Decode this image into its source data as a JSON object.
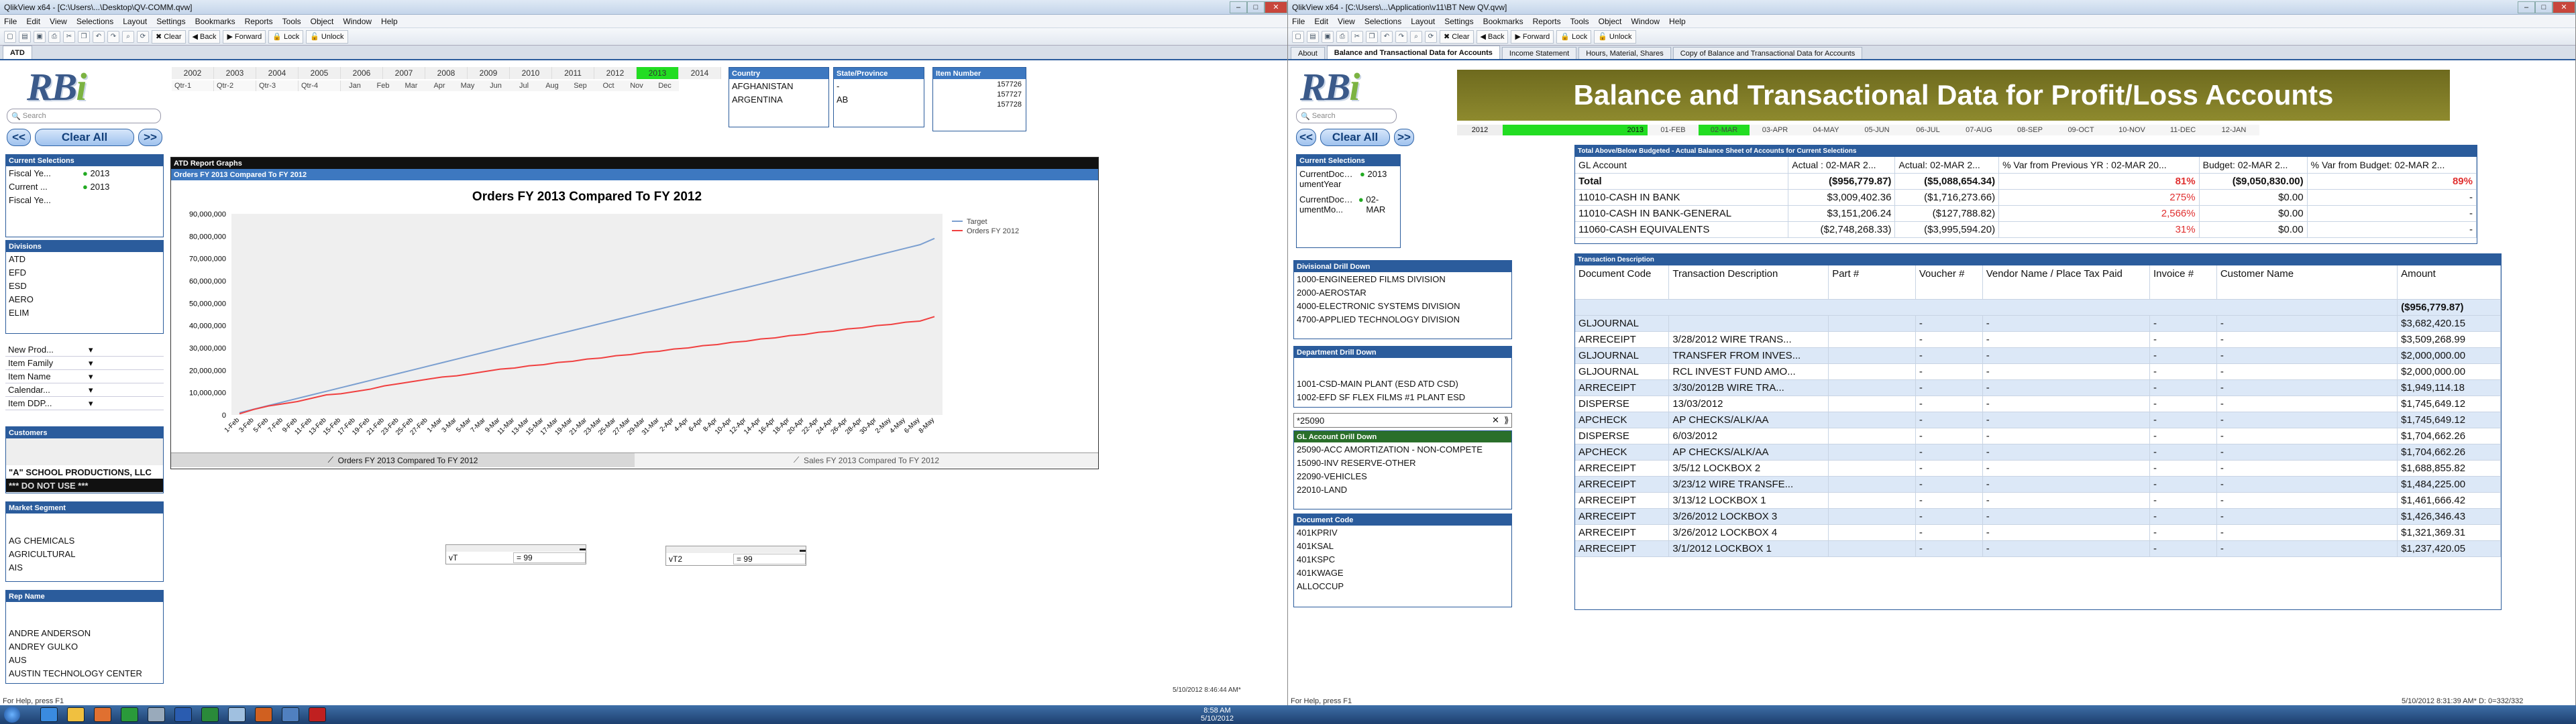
{
  "left": {
    "title": "QlikView x64 - [C:\\Users\\...\\Desktop\\QV-COMM.qvw]",
    "menu": [
      "File",
      "Edit",
      "View",
      "Selections",
      "Layout",
      "Settings",
      "Bookmarks",
      "Reports",
      "Tools",
      "Object",
      "Window",
      "Help"
    ],
    "toolbar": {
      "clear": "Clear",
      "back": "Back",
      "forward": "Forward",
      "lock": "Lock",
      "unlock": "Unlock"
    },
    "tab": "ATD",
    "search_placeholder": "Search",
    "clear_all": "Clear All",
    "years": [
      "2002",
      "2003",
      "2004",
      "2005",
      "2006",
      "2007",
      "2008",
      "2009",
      "2010",
      "2011",
      "2012",
      "2013",
      "2014"
    ],
    "quarters": [
      "Qtr-1",
      "Qtr-2",
      "Qtr-3",
      "Qtr-4"
    ],
    "months": [
      "Jan",
      "Feb",
      "Mar",
      "Apr",
      "May",
      "Jun",
      "Jul",
      "Aug",
      "Sep",
      "Oct",
      "Nov",
      "Dec"
    ],
    "country": {
      "title": "Country",
      "items": [
        "AFGHANISTAN",
        "ARGENTINA"
      ]
    },
    "state": {
      "title": "State/Province",
      "items": [
        "-",
        "AB"
      ]
    },
    "item": {
      "title": "Item Number",
      "items": [
        "157726",
        "157727",
        "157728"
      ]
    },
    "current": {
      "title": "Current Selections",
      "rows": [
        {
          "k": "Fiscal Ye...",
          "v": "2013"
        },
        {
          "k": "Current ...",
          "v": "2013"
        },
        {
          "k": "Fiscal Ye...",
          "v": ""
        }
      ]
    },
    "divisions": {
      "title": "Divisions",
      "items": [
        "ATD",
        "EFD",
        "ESD",
        "AERO",
        "ELIM"
      ]
    },
    "filters": [
      "New Prod...",
      "Item Family",
      "Item Name",
      "Calendar...",
      "Item DDP..."
    ],
    "customers": {
      "title": "Customers",
      "items": [
        "\"A\" SCHOOL PRODUCTIONS, LLC",
        "*** DO NOT USE ***"
      ]
    },
    "market": {
      "title": "Market Segment",
      "items": [
        "AG CHEMICALS",
        "AGRICULTURAL",
        "AIS"
      ]
    },
    "rep": {
      "title": "Rep Name",
      "items": [
        "ANDRE ANDERSON",
        "ANDREY GULKO",
        "AUS",
        "AUSTIN TECHNOLOGY CENTER"
      ]
    },
    "graphs_title": "ATD Report Graphs",
    "graph_caption": "Orders FY 2013 Compared To FY 2012",
    "bottom_tabs": [
      "Orders FY 2013 Compared To FY 2012",
      "Sales FY 2013 Compared To FY 2012"
    ],
    "vt1": {
      "label": "vT",
      "value": "= 99"
    },
    "vt2": {
      "label": "vT2",
      "value": "= 99"
    },
    "status_left": "For Help, press F1",
    "status_right": "5/10/2012 8:46:44 AM*"
  },
  "chart_data": {
    "type": "line",
    "title": "Orders FY 2013 Compared To FY 2012",
    "ylim": [
      0,
      90000000
    ],
    "yticks": [
      0,
      10000000,
      20000000,
      30000000,
      40000000,
      50000000,
      60000000,
      70000000,
      80000000,
      90000000
    ],
    "x": [
      "1-Feb",
      "3-Feb",
      "5-Feb",
      "7-Feb",
      "9-Feb",
      "11-Feb",
      "13-Feb",
      "15-Feb",
      "17-Feb",
      "19-Feb",
      "21-Feb",
      "23-Feb",
      "25-Feb",
      "27-Feb",
      "1-Mar",
      "3-Mar",
      "5-Mar",
      "7-Mar",
      "9-Mar",
      "11-Mar",
      "13-Mar",
      "15-Mar",
      "17-Mar",
      "19-Mar",
      "21-Mar",
      "23-Mar",
      "25-Mar",
      "27-Mar",
      "29-Mar",
      "31-Mar",
      "2-Apr",
      "4-Apr",
      "6-Apr",
      "8-Apr",
      "10-Apr",
      "12-Apr",
      "14-Apr",
      "16-Apr",
      "18-Apr",
      "20-Apr",
      "22-Apr",
      "24-Apr",
      "26-Apr",
      "28-Apr",
      "30-Apr",
      "2-May",
      "4-May",
      "6-May",
      "8-May"
    ],
    "series": [
      {
        "name": "Target",
        "color": "#7b9fd0",
        "values": [
          1000000,
          2600000,
          4200000,
          5800000,
          7400000,
          9000000,
          10600000,
          12200000,
          13800000,
          15400000,
          17000000,
          18600000,
          20200000,
          21800000,
          23400000,
          25000000,
          26600000,
          28200000,
          29800000,
          31400000,
          33000000,
          34600000,
          36200000,
          37800000,
          39400000,
          41000000,
          42600000,
          44200000,
          45800000,
          47400000,
          49000000,
          50600000,
          52200000,
          53800000,
          55400000,
          57000000,
          58600000,
          60200000,
          61800000,
          63400000,
          65000000,
          66600000,
          68200000,
          69800000,
          71400000,
          73000000,
          74600000,
          76200000,
          79000000
        ]
      },
      {
        "name": "Orders FY 2012",
        "color": "#f04040",
        "values": [
          500000,
          2500000,
          4000000,
          5000000,
          6000000,
          7500000,
          9000000,
          9500000,
          10500000,
          11500000,
          13000000,
          14000000,
          15000000,
          16000000,
          17000000,
          17500000,
          18500000,
          19500000,
          20500000,
          21000000,
          22000000,
          22500000,
          23500000,
          24000000,
          25000000,
          25500000,
          26500000,
          27000000,
          28000000,
          28500000,
          29500000,
          30000000,
          31000000,
          31500000,
          32500000,
          33000000,
          34000000,
          34500000,
          35500000,
          36000000,
          37000000,
          37500000,
          38500000,
          39000000,
          40000000,
          40500000,
          41500000,
          42000000,
          44000000
        ]
      }
    ]
  },
  "right": {
    "title": "QlikView x64 - [C:\\Users\\...\\Application\\v11\\BT New QV.qvw]",
    "menu": [
      "File",
      "Edit",
      "View",
      "Selections",
      "Layout",
      "Settings",
      "Bookmarks",
      "Reports",
      "Tools",
      "Object",
      "Window",
      "Help"
    ],
    "toolbar": {
      "clear": "Clear",
      "back": "Back",
      "forward": "Forward",
      "lock": "Lock",
      "unlock": "Unlock"
    },
    "tabs": [
      "About",
      "Balance and Transactional Data for Accounts",
      "Income Statement",
      "Hours, Material, Shares",
      "Copy of Balance and Transactional Data for Accounts"
    ],
    "search_placeholder": "Search",
    "clear_all": "Clear All",
    "banner": "Balance and Transactional Data for Profit/Loss Accounts",
    "years": [
      "2012",
      "2013"
    ],
    "months": [
      "01-FEB",
      "02-MAR",
      "03-APR",
      "04-MAY",
      "05-JUN",
      "06-JUL",
      "07-AUG",
      "08-SEP",
      "09-OCT",
      "10-NOV",
      "11-DEC",
      "12-JAN"
    ],
    "current": {
      "title": "Current Selections",
      "rows": [
        {
          "k": "CurrentDoc…umentYear",
          "v": "2013"
        },
        {
          "k": "CurrentDoc…umentMo...",
          "v": "02-MAR"
        }
      ]
    },
    "divisional": {
      "title": "Divisional Drill Down",
      "items": [
        "1000-ENGINEERED FILMS DIVISION",
        "2000-AEROSTAR",
        "4000-ELECTRONIC SYSTEMS DIVISION",
        "4700-APPLIED TECHNOLOGY DIVISION"
      ]
    },
    "department": {
      "title": "Department Drill Down",
      "items": [
        "1001-CSD-MAIN PLANT (ESD ATD CSD)",
        "1002-EFD SF FLEX FILMS #1 PLANT ESD"
      ]
    },
    "gl_search": "*25090",
    "gl": {
      "title": "GL Account Drill Down",
      "items": [
        "25090-ACC AMORTIZATION - NON-COMPETE",
        "15090-INV RESERVE-OTHER",
        "22090-VEHICLES",
        "22010-LAND"
      ]
    },
    "doccode": {
      "title": "Document Code",
      "items": [
        "401KPRIV",
        "401KSAL",
        "401KSPC",
        "401KWAGE",
        "ALLOCCUP"
      ]
    },
    "summary": {
      "title": "Total Above/Below Budgeted - Actual Balance Sheet of Accounts for Current Selections",
      "headers": [
        "GL Account",
        "Actual : 02-MAR 2...",
        "Actual: 02-MAR 2...",
        "% Var from Previous YR : 02-MAR 20...",
        "Budget: 02-MAR 2...",
        "% Var from Budget: 02-MAR 2..."
      ],
      "rows": [
        [
          "Total",
          "($956,779.87)",
          "($5,088,654.34)",
          "81%",
          "($9,050,830.00)",
          "89%"
        ],
        [
          "11010-CASH IN BANK",
          "$3,009,402.36",
          "($1,716,273.66)",
          "275%",
          "$0.00",
          "-"
        ],
        [
          "11010-CASH IN BANK-GENERAL",
          "$3,151,206.24",
          "($127,788.82)",
          "2,566%",
          "$0.00",
          "-"
        ],
        [
          "11060-CASH EQUIVALENTS",
          "($2,748,268.33)",
          "($3,995,594.20)",
          "31%",
          "$0.00",
          "-"
        ]
      ]
    },
    "trans": {
      "title": "Transaction Description",
      "headers": [
        "Document Code",
        "Transaction Description",
        "Part #",
        "Voucher #",
        "Vendor Name / Place Tax Paid",
        "Invoice #",
        "Customer Name",
        "Amount"
      ],
      "total": "($956,779.87)",
      "rows": [
        [
          "GLJOURNAL",
          "",
          "",
          "-",
          "-",
          "-",
          "-",
          "$3,682,420.15"
        ],
        [
          "ARRECEIPT",
          "3/28/2012 WIRE TRANS...",
          "",
          "-",
          "-",
          "-",
          "-",
          "$3,509,268.99"
        ],
        [
          "GLJOURNAL",
          "TRANSFER FROM INVES...",
          "",
          "-",
          "-",
          "-",
          "-",
          "$2,000,000.00"
        ],
        [
          "GLJOURNAL",
          "RCL INVEST FUND AMO...",
          "",
          "-",
          "-",
          "-",
          "-",
          "$2,000,000.00"
        ],
        [
          "ARRECEIPT",
          "3/30/2012B WIRE TRA...",
          "",
          "-",
          "-",
          "-",
          "-",
          "$1,949,114.18"
        ],
        [
          "DISPERSE",
          "13/03/2012",
          "",
          "-",
          "-",
          "-",
          "-",
          "$1,745,649.12"
        ],
        [
          "APCHECK",
          "AP CHECKS/ALK/AA",
          "",
          "-",
          "-",
          "-",
          "-",
          "$1,745,649.12"
        ],
        [
          "DISPERSE",
          "6/03/2012",
          "",
          "-",
          "-",
          "-",
          "-",
          "$1,704,662.26"
        ],
        [
          "APCHECK",
          "AP CHECKS/ALK/AA",
          "",
          "-",
          "-",
          "-",
          "-",
          "$1,704,662.26"
        ],
        [
          "ARRECEIPT",
          "3/5/12 LOCKBOX 2",
          "",
          "-",
          "-",
          "-",
          "-",
          "$1,688,855.82"
        ],
        [
          "ARRECEIPT",
          "3/23/12 WIRE TRANSFE...",
          "",
          "-",
          "-",
          "-",
          "-",
          "$1,484,225.00"
        ],
        [
          "ARRECEIPT",
          "3/13/12 LOCKBOX 1",
          "",
          "-",
          "-",
          "-",
          "-",
          "$1,461,666.42"
        ],
        [
          "ARRECEIPT",
          "3/26/2012 LOCKBOX 3",
          "",
          "-",
          "-",
          "-",
          "-",
          "$1,426,346.43"
        ],
        [
          "ARRECEIPT",
          "3/26/2012 LOCKBOX 4",
          "",
          "-",
          "-",
          "-",
          "-",
          "$1,321,369.31"
        ],
        [
          "ARRECEIPT",
          "3/1/2012 LOCKBOX 1",
          "",
          "-",
          "-",
          "-",
          "-",
          "$1,237,420.05"
        ]
      ]
    },
    "status_left": "For Help, press F1",
    "status_right": "5/10/2012 8:31:39 AM*   D: 0=332/332"
  },
  "clock": {
    "time": "8:58 AM",
    "date": "5/10/2012"
  }
}
